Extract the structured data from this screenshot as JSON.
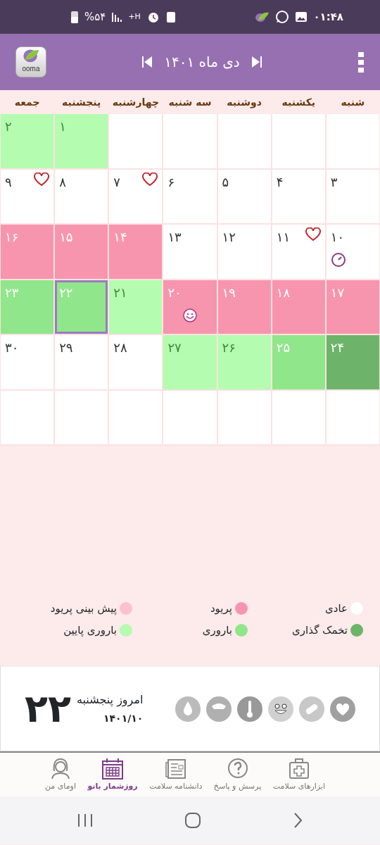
{
  "status_bar": {
    "time": "۰۱:۴۸",
    "battery": "%۵۴",
    "network": "H+"
  },
  "header": {
    "title": "دی ماه ۱۴۰۱",
    "logo": "ooma"
  },
  "weekdays": [
    "شنبه",
    "یکشنبه",
    "دوشنبه",
    "سه شنبه",
    "چهارشنبه",
    "پنجشنبه",
    "جمعه"
  ],
  "calendar": [
    {
      "kind": "empty",
      "selected": false
    },
    {
      "kind": "empty",
      "selected": false
    },
    {
      "kind": "empty",
      "selected": false
    },
    {
      "kind": "empty",
      "selected": false
    },
    {
      "kind": "empty",
      "selected": false
    },
    {
      "day": "۱",
      "kind": "low_fertility",
      "selected": false
    },
    {
      "day": "۲",
      "kind": "low_fertility",
      "selected": false
    },
    {
      "day": "۳",
      "kind": "normal",
      "selected": false
    },
    {
      "day": "۴",
      "kind": "normal",
      "selected": false
    },
    {
      "day": "۵",
      "kind": "normal",
      "selected": false
    },
    {
      "day": "۶",
      "kind": "normal",
      "selected": false
    },
    {
      "day": "۷",
      "kind": "normal",
      "selected": false,
      "marker": {
        "kind": "heart"
      }
    },
    {
      "day": "۸",
      "kind": "normal",
      "selected": false
    },
    {
      "day": "۹",
      "kind": "normal",
      "selected": false,
      "marker": {
        "kind": "heart"
      }
    },
    {
      "day": "۱۰",
      "kind": "normal",
      "selected": false,
      "marker": {
        "kind": "gauge"
      }
    },
    {
      "day": "۱۱",
      "kind": "normal",
      "selected": false,
      "marker": {
        "kind": "heart"
      }
    },
    {
      "day": "۱۲",
      "kind": "normal",
      "selected": false
    },
    {
      "day": "۱۳",
      "kind": "normal",
      "selected": false
    },
    {
      "day": "۱۴",
      "kind": "period",
      "selected": false
    },
    {
      "day": "۱۵",
      "kind": "period",
      "selected": false
    },
    {
      "day": "۱۶",
      "kind": "period",
      "selected": false
    },
    {
      "day": "۱۷",
      "kind": "period",
      "selected": false
    },
    {
      "day": "۱۸",
      "kind": "period",
      "selected": false
    },
    {
      "day": "۱۹",
      "kind": "period",
      "selected": false
    },
    {
      "day": "۲۰",
      "kind": "period",
      "selected": false,
      "marker": {
        "kind": "smiley"
      }
    },
    {
      "day": "۲۱",
      "kind": "low_fertility",
      "selected": false
    },
    {
      "day": "۲۲",
      "kind": "fertility",
      "selected": true
    },
    {
      "day": "۲۳",
      "kind": "fertility",
      "selected": false
    },
    {
      "day": "۲۴",
      "kind": "ovulation",
      "selected": false
    },
    {
      "day": "۲۵",
      "kind": "fertility",
      "selected": false
    },
    {
      "day": "۲۶",
      "kind": "low_fertility",
      "selected": false
    },
    {
      "day": "۲۷",
      "kind": "low_fertility",
      "selected": false
    },
    {
      "day": "۲۸",
      "kind": "normal",
      "selected": false
    },
    {
      "day": "۲۹",
      "kind": "normal",
      "selected": false
    },
    {
      "day": "۳۰",
      "kind": "normal",
      "selected": false
    },
    {
      "kind": "empty",
      "selected": false
    },
    {
      "kind": "empty",
      "selected": false
    },
    {
      "kind": "empty",
      "selected": false
    },
    {
      "kind": "empty",
      "selected": false
    },
    {
      "kind": "empty",
      "selected": false
    },
    {
      "kind": "empty",
      "selected": false
    },
    {
      "kind": "empty",
      "selected": false
    }
  ],
  "legend": [
    {
      "label": "عادی",
      "color": "#ffffff"
    },
    {
      "label": "پریود",
      "color": "#f895ae"
    },
    {
      "label": "پیش بینی پریود",
      "color": "#fcc0cf"
    },
    {
      "label": "تخمک گذاری",
      "color": "#6db46a"
    },
    {
      "label": "باروری",
      "color": "#90e68a"
    },
    {
      "label": "باروری پایین",
      "color": "#b4fcb0"
    }
  ],
  "today": {
    "day": "۲۲",
    "label": "امروز پنجشنبه",
    "date": "۱۴۰۱/۱۰"
  },
  "bottom_nav": [
    {
      "label": "ابزارهای سلامت",
      "selected": false
    },
    {
      "label": "پرسش و پاسخ",
      "selected": false
    },
    {
      "label": "دانشنامه سلامت",
      "selected": false
    },
    {
      "label": "روزشمار بانو",
      "selected": true
    },
    {
      "label": "اومای من",
      "selected": false
    }
  ]
}
